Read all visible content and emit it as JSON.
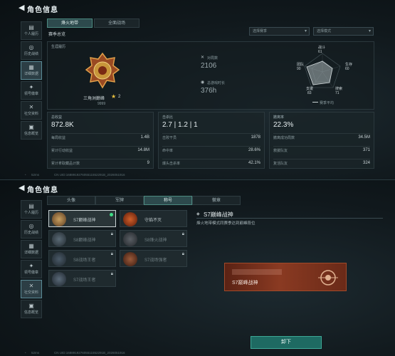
{
  "top": {
    "title": "角色信息",
    "sidebar": [
      {
        "icon": "▤",
        "label": "个人履历"
      },
      {
        "icon": "◎",
        "label": "历史战绩"
      },
      {
        "icon": "▦",
        "label": "详细数据"
      },
      {
        "icon": "✦",
        "label": "领号徽章"
      },
      {
        "icon": "✕",
        "label": "社交资料"
      },
      {
        "icon": "▣",
        "label": "信息概览"
      }
    ],
    "tabs": [
      "烽火地带",
      "全面战场"
    ],
    "season_label": "赛季总览",
    "sel1": "选择赛季",
    "sel2": "选择模式",
    "career_label": "生涯履历",
    "rank_name": "三角洲巅峰",
    "rank_stars": "2",
    "rank_score": "9999",
    "stat1_label": "对局数",
    "stat1_value": "2106",
    "stat2_label": "总游戏时长",
    "stat2_value": "376h",
    "radar": {
      "labels": [
        "战斗",
        "生存",
        "搜索",
        "支援",
        "团队"
      ],
      "values": [
        "61",
        "60",
        "71",
        "83",
        "90"
      ],
      "legend": "赛季平均"
    },
    "cards": [
      {
        "head": "总收益",
        "big": "872.8K",
        "rows": [
          {
            "k": "每局收益",
            "v": "1.4B"
          },
          {
            "k": "累计行动收益",
            "v": "14.8M"
          },
          {
            "k": "累计拿取藏品计数",
            "v": "9"
          }
        ]
      },
      {
        "head": "击杀比",
        "big": "2.7 | 1.2 | 1",
        "rows": [
          {
            "k": "击败干员",
            "v": "1878"
          },
          {
            "k": "命中率",
            "v": "28.6%"
          },
          {
            "k": "爆头击杀率",
            "v": "42.1%"
          }
        ]
      },
      {
        "head": "撤离率",
        "big": "22.3%",
        "rows": [
          {
            "k": "撤离成功局数",
            "v": "34.5M"
          },
          {
            "k": "救援队友",
            "v": "371"
          },
          {
            "k": "复活队友",
            "v": "324"
          }
        ]
      }
    ],
    "footer_left": "52ms",
    "footer_uid": "CN UID:168891927605511552291B_2026051916"
  },
  "bottom": {
    "title": "角色信息",
    "tabs": [
      "头像",
      "军牌",
      "称号",
      "徽章"
    ],
    "items": [
      {
        "name": "S7巅峰战神",
        "color": "#7a5a3a",
        "locked": false,
        "selected": true
      },
      {
        "name": "守焰不灭",
        "color": "#8a3a1a",
        "locked": false,
        "selected": false
      },
      {
        "name": "S8巅峰战神",
        "color": "#3a4a55",
        "locked": true,
        "selected": false
      },
      {
        "name": "S8烽火战神",
        "color": "#3a3f45",
        "locked": true,
        "selected": false
      },
      {
        "name": "S8战场王者",
        "color": "#344450",
        "locked": true,
        "selected": false
      },
      {
        "name": "S7战场强者",
        "color": "#6a3a2a",
        "locked": true,
        "selected": false
      },
      {
        "name": "S7战场王者",
        "color": "#3a4a58",
        "locked": true,
        "selected": false
      }
    ],
    "detail_title": "S7巅峰战神",
    "detail_desc": "烽火地带模式同赛季达到巅峰段位",
    "preview_name": "S7巅峰战神",
    "button": "卸下",
    "footer_left": "52ms",
    "footer_uid": "CN UID:168891927605511552291B_2026051916"
  },
  "colors": {
    "accent": "#3d8f7a",
    "brand_gold": "#c8963a",
    "button": "#1e6a62"
  }
}
